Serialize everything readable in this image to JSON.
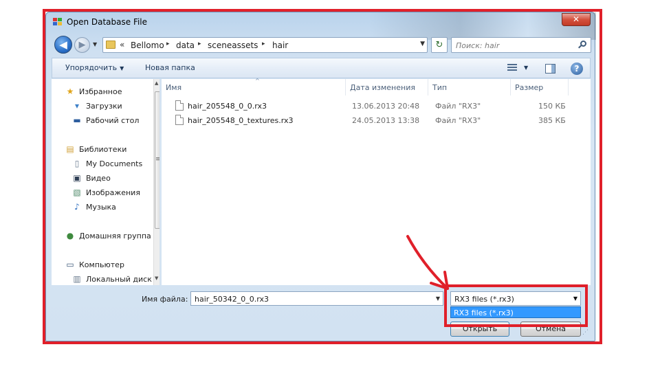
{
  "window": {
    "title": "Open Database File",
    "close_label": "✕"
  },
  "nav": {
    "back_label": "◀",
    "forward_label": "▶",
    "history_caret": "▼",
    "breadcrumb_prefix": "«",
    "breadcrumbs": [
      "Bellomo",
      "data",
      "sceneassets",
      "hair"
    ],
    "crumb_separator": "▸",
    "address_dropdown": "▼",
    "refresh_label": "↻"
  },
  "search": {
    "placeholder": "Поиск: hair"
  },
  "toolbar": {
    "organize_label": "Упорядочить",
    "organize_caret": "▼",
    "new_folder_label": "Новая папка",
    "view_caret": "▼",
    "help_label": "?"
  },
  "sidebar": {
    "items": [
      {
        "label": "Избранное",
        "icon": "star-icon",
        "glyph": "★",
        "color": "#e0a51b"
      },
      {
        "label": "Загрузки",
        "icon": "downloads-folder-icon",
        "glyph": "▾",
        "color": "#3c7fc8"
      },
      {
        "label": "Рабочий стол",
        "icon": "desktop-icon",
        "glyph": "▬",
        "color": "#2d5e9e"
      },
      {
        "label": "Библиотеки",
        "icon": "libraries-icon",
        "glyph": "▤",
        "color": "#d2a23c"
      },
      {
        "label": "My Documents",
        "icon": "document-icon",
        "glyph": "▯",
        "color": "#6d7e93"
      },
      {
        "label": "Видео",
        "icon": "video-icon",
        "glyph": "▣",
        "color": "#2f3f55"
      },
      {
        "label": "Изображения",
        "icon": "images-icon",
        "glyph": "▧",
        "color": "#4f8a6a"
      },
      {
        "label": "Музыка",
        "icon": "music-icon",
        "glyph": "♪",
        "color": "#2f6fbf"
      },
      {
        "label": "Домашняя группа",
        "icon": "homegroup-icon",
        "glyph": "●",
        "color": "#3f8a3f"
      },
      {
        "label": "Компьютер",
        "icon": "computer-icon",
        "glyph": "▭",
        "color": "#3d5a7a"
      },
      {
        "label": "Локальный диск",
        "icon": "disk-icon",
        "glyph": "▥",
        "color": "#6b7c8f"
      }
    ],
    "scroll_up": "▲",
    "scroll_down": "▼",
    "scroll_grip": "≡"
  },
  "file_list": {
    "sort_caret": "^",
    "columns": [
      "Имя",
      "Дата изменения",
      "Тип",
      "Размер"
    ],
    "rows": [
      {
        "name": "hair_205548_0_0.rx3",
        "date": "13.06.2013 20:48",
        "type": "Файл \"RX3\"",
        "size": "150 КБ"
      },
      {
        "name": "hair_205548_0_textures.rx3",
        "date": "24.05.2013 13:38",
        "type": "Файл \"RX3\"",
        "size": "385 КБ"
      }
    ]
  },
  "bottom": {
    "filename_label": "Имя файла:",
    "filename_value": "hair_50342_0_0.rx3",
    "filename_dropdown": "▼",
    "filetype_value": "RX3 files (*.rx3)",
    "filetype_dropdown": "▼",
    "filetype_option": "RX3 files (*.rx3)",
    "open_label": "Открыть",
    "cancel_label": "Отмена",
    "resize_grip": "⋰"
  },
  "annotation": {
    "color": "#e0202a"
  }
}
